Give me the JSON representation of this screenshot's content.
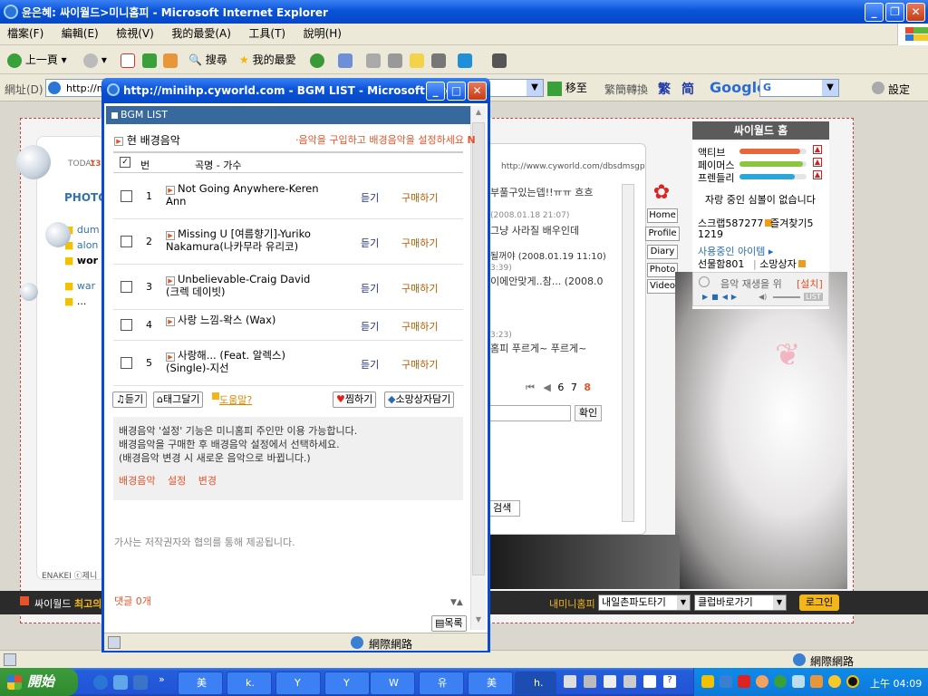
{
  "ie": {
    "title": "윤은혜: 싸이월드>미니홈피 - Microsoft Internet Explorer",
    "menu": [
      "檔案(F)",
      "編輯(E)",
      "檢視(V)",
      "我的最愛(A)",
      "工具(T)",
      "說明(H)"
    ],
    "toolbar": {
      "back": "上一頁",
      "search": "搜尋",
      "favorites": "我的最愛"
    },
    "address": {
      "label": "網址(D)",
      "value": "http://mi",
      "go": "移至",
      "convert": "繁簡轉換",
      "trad": "繁",
      "simp": "简",
      "google": "Google",
      "google_box": "G",
      "settings": "設定"
    },
    "status": "網際網路"
  },
  "page": {
    "today_label": "TODAY",
    "today_value": "13",
    "photo_label": "PHOTO",
    "folders": [
      "dum",
      "alon",
      "wor",
      "war",
      "..."
    ],
    "url_text": "http://www.cyworld.com/dbsdmsgp",
    "comments": [
      {
        "text": "부풀구있는뎁!!ㅠㅠ 흐흐"
      },
      {
        "text": "(2008.01.18 21:07)"
      },
      {
        "text": "그냥 사라질 배우인데"
      },
      {
        "text": "될꺼야 (2008.01.19 11:10)"
      },
      {
        "text": "3:39)"
      },
      {
        "text": "이에안맞게..참... (2008.0"
      },
      {
        "text": "3:23)"
      },
      {
        "text": "홈피 푸르게~ 푸르게~"
      }
    ],
    "pager": [
      "6",
      "7",
      "8"
    ],
    "confirm": "확인",
    "search": "검색",
    "footer_text": "ENAKEI ⓒ제니",
    "cyworld_bar": "싸이월드",
    "cyworld_bar2": "최고의",
    "tabs": [
      "Home",
      "Profile",
      "Diary",
      "Photo",
      "Video"
    ],
    "right": {
      "title": "싸이월드 홈",
      "gauges": [
        {
          "label": "액티브",
          "color": "#e8673a",
          "fill": 0.9
        },
        {
          "label": "페이머스",
          "color": "#8cc63f",
          "fill": 0.94
        },
        {
          "label": "프렌들리",
          "color": "#2aa6d9",
          "fill": 0.82
        }
      ],
      "no_simbol": "자랑 중인 심볼이 없습니다",
      "scrap": "스크랩587277",
      "fav": "즐겨찾기5",
      "fav2": "1219",
      "items_in_use": "사용중인 아이템 ▸",
      "gift": "선물함801",
      "wishbox": "소망상자",
      "music": "음악 재생을 위",
      "install": "[설치]",
      "list": "LIST",
      "minihp": "내미니홈피",
      "select1": "내일촌파도타기",
      "select2": "클럽바로가기",
      "login": "로그인"
    }
  },
  "popup": {
    "title": "http://minihp.cyworld.com - BGM LIST - Microsoft Inte...",
    "header": "BGM LIST",
    "section_title": "현 배경음악",
    "section_link": "·음악을 구입하고 배경음악을 설정하세요",
    "section_link_n": "N",
    "col_no": "번",
    "col_title": "곡명 - 가수",
    "rows": [
      {
        "n": "1",
        "title": "Not Going Anywhere-Keren Ann",
        "listen": "듣기",
        "buy": "구매하기"
      },
      {
        "n": "2",
        "title": "Missing U [여름향기]-Yuriko Nakamura(나카무라 유리코)",
        "listen": "듣기",
        "buy": "구매하기"
      },
      {
        "n": "3",
        "title": "Unbelievable-Craig David (크렉 데이빗)",
        "listen": "듣기",
        "buy": "구매하기"
      },
      {
        "n": "4",
        "title": "사랑 느낌-왁스 (Wax)",
        "listen": "듣기",
        "buy": "구매하기"
      },
      {
        "n": "5",
        "title": "사랑해... (Feat. 알렉스) (Single)-지선",
        "listen": "듣기",
        "buy": "구매하기"
      }
    ],
    "btn_listen": "듣기",
    "btn_tag": "태그달기",
    "btn_help": "도움말?",
    "btn_jjim": "찜하기",
    "btn_wish": "소망상자담기",
    "notice1": "배경음악 '설정' 기능은 미니홈피 주인만 이용 가능합니다.",
    "notice2": "배경음악을 구매한 후 배경음악 설정에서 선택하세요.",
    "notice3": "(배경음악 변경 시 새로운 음악으로 바뀝니다.)",
    "link_bgm": "배경음악",
    "link_a": "설정",
    "link_b": "변경",
    "lyrics": "가사는 저작권자와 협의를 통해 제공됩니다.",
    "reply_count": "댓글 0개",
    "list_btn": "목록",
    "status": "網際網路"
  },
  "taskbar": {
    "start": "開始",
    "tasks": [
      "Y",
      "Y",
      "W",
      "유",
      "美",
      "h.",
      "k."
    ],
    "time": "上午 04:09"
  }
}
